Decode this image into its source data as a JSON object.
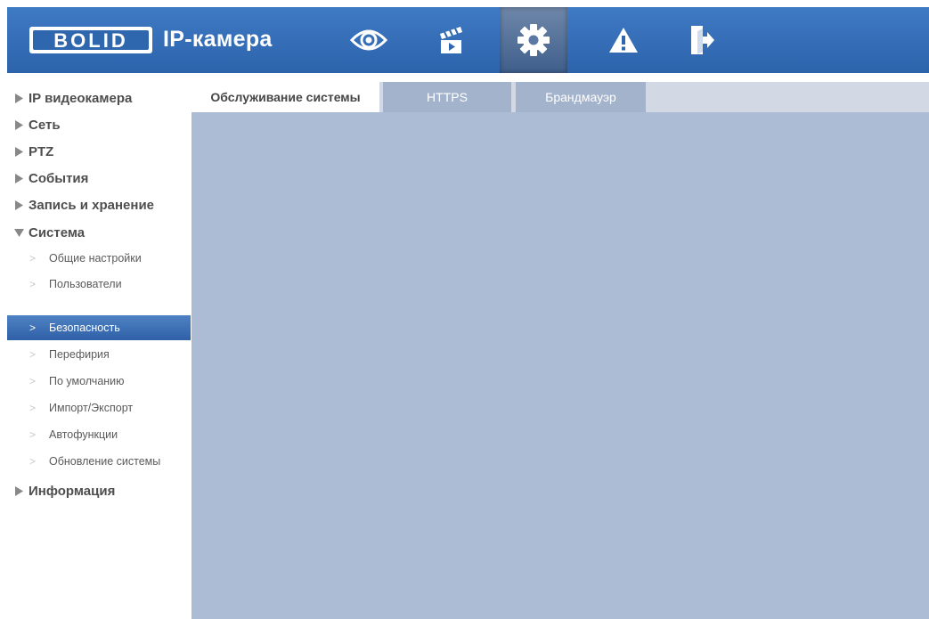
{
  "header": {
    "logo_text": "BOLID",
    "brand": "IP-камера",
    "nav": [
      {
        "icon": "eye-icon",
        "label": "live-view"
      },
      {
        "icon": "clapperboard-icon",
        "label": "playback"
      },
      {
        "icon": "gear-icon",
        "label": "settings"
      },
      {
        "icon": "warning-icon",
        "label": "alarm"
      },
      {
        "icon": "logout-icon",
        "label": "logout"
      }
    ]
  },
  "sidebar": {
    "categories": [
      {
        "label": "IP видеокамера",
        "expanded": false
      },
      {
        "label": "Сеть",
        "expanded": false
      },
      {
        "label": "PTZ",
        "expanded": false
      },
      {
        "label": "События",
        "expanded": false
      },
      {
        "label": "Запись и хранение",
        "expanded": false
      },
      {
        "label": "Система",
        "expanded": true
      },
      {
        "label": "Информация",
        "expanded": false
      }
    ],
    "system_items": [
      "Общие настройки",
      "Пользователи",
      "Безопасность",
      "Перефирия",
      "По умолчанию",
      "Импорт/Экспорт",
      "Автофункции",
      "Обновление системы"
    ],
    "selected_item": "Безопасность"
  },
  "tabs": [
    {
      "label": "Обслуживание системы",
      "active": true
    },
    {
      "label": "HTTPS",
      "active": false
    },
    {
      "label": "Брандмауэр",
      "active": false
    }
  ],
  "colors": {
    "header": "#2f67ae",
    "selected": "#3a6db5",
    "content_bg": "#adbcd5",
    "tab_inactive": "#a3b3cc"
  }
}
